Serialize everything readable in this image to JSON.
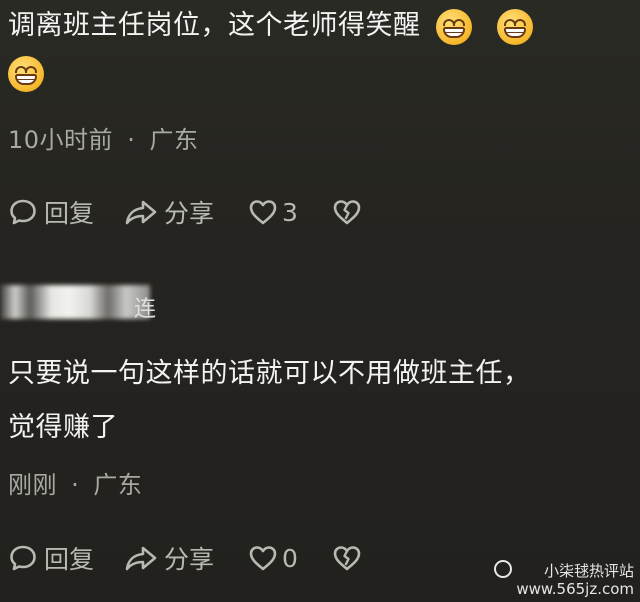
{
  "comment1": {
    "text": "调离班主任岗位，这个老师得笑醒",
    "emoji": "grinning-face-emoji",
    "time": "10小时前",
    "separator": "·",
    "location": "广东",
    "reply_label": "回复",
    "share_label": "分享",
    "like_count": "3"
  },
  "comment2": {
    "username_tail": "连",
    "text_line1": "只要说一句这样的话就可以不用做班主任，",
    "text_line2": "觉得赚了",
    "time": "刚刚",
    "separator": "·",
    "location": "广东",
    "reply_label": "回复",
    "share_label": "分享",
    "like_count": "0"
  },
  "watermark": {
    "name": "小柒毬热评站",
    "url": "www.565jz.com"
  },
  "colors": {
    "background": "#252420",
    "text": "#f3f3f3",
    "meta": "#a9a9a4",
    "actions": "#b9b9b4"
  }
}
